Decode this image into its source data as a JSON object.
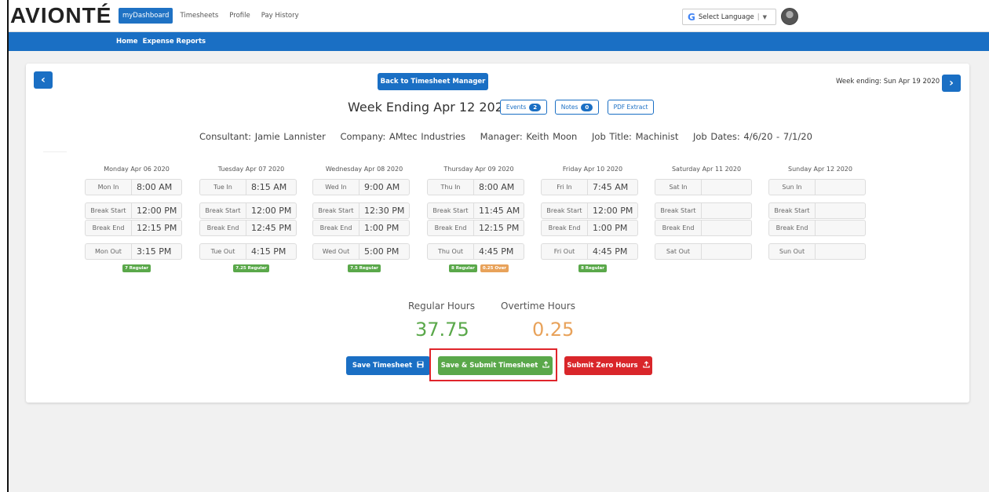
{
  "header": {
    "logo": "AVIONTÉ",
    "nav": [
      "myDashboard",
      "Timesheets",
      "Profile",
      "Pay History"
    ],
    "language_label": "Select Language",
    "language_sep": "|",
    "language_arrow": "▼"
  },
  "subnav": [
    "Home",
    "Expense Reports"
  ],
  "toolbar": {
    "prev_icon": "‹",
    "next_icon": "›",
    "back_label": "Back to Timesheet Manager",
    "week_ending_right": "Week ending: Sun Apr 19 2020"
  },
  "week": {
    "title": "Week Ending Apr 12 2020",
    "events_label": "Events",
    "events_count": "2",
    "notes_label": "Notes",
    "notes_count": "0",
    "pdf_label": "PDF Extract"
  },
  "info": {
    "consultant": "Consultant: Jamie Lannister",
    "company": "Company: AMtec Industries",
    "manager": "Manager: Keith Moon",
    "job_title": "Job Title: Machinist",
    "job_dates": "Job Dates: 4/6/20 - 7/1/20"
  },
  "days": [
    {
      "label": "Monday Apr 06 2020",
      "in_label": "Mon In",
      "in": "8:00 AM",
      "bs_label": "Break Start",
      "bs": "12:00 PM",
      "be_label": "Break End",
      "be": "12:15 PM",
      "out_label": "Mon Out",
      "out": "3:15 PM",
      "regular": "7 Regular",
      "over": ""
    },
    {
      "label": "Tuesday Apr 07 2020",
      "in_label": "Tue In",
      "in": "8:15 AM",
      "bs_label": "Break Start",
      "bs": "12:00 PM",
      "be_label": "Break End",
      "be": "12:45 PM",
      "out_label": "Tue Out",
      "out": "4:15 PM",
      "regular": "7.25 Regular",
      "over": ""
    },
    {
      "label": "Wednesday Apr 08 2020",
      "in_label": "Wed In",
      "in": "9:00 AM",
      "bs_label": "Break Start",
      "bs": "12:30 PM",
      "be_label": "Break End",
      "be": "1:00 PM",
      "out_label": "Wed Out",
      "out": "5:00 PM",
      "regular": "7.5 Regular",
      "over": ""
    },
    {
      "label": "Thursday Apr 09 2020",
      "in_label": "Thu In",
      "in": "8:00 AM",
      "bs_label": "Break Start",
      "bs": "11:45 AM",
      "be_label": "Break End",
      "be": "12:15 PM",
      "out_label": "Thu Out",
      "out": "4:45 PM",
      "regular": "8 Regular",
      "over": "0.25 Over"
    },
    {
      "label": "Friday Apr 10 2020",
      "in_label": "Fri In",
      "in": "7:45 AM",
      "bs_label": "Break Start",
      "bs": "12:00 PM",
      "be_label": "Break End",
      "be": "1:00 PM",
      "out_label": "Fri Out",
      "out": "4:45 PM",
      "regular": "8 Regular",
      "over": ""
    },
    {
      "label": "Saturday Apr 11 2020",
      "in_label": "Sat In",
      "in": "",
      "bs_label": "Break Start",
      "bs": "",
      "be_label": "Break End",
      "be": "",
      "out_label": "Sat Out",
      "out": "",
      "regular": "",
      "over": ""
    },
    {
      "label": "Sunday Apr 12 2020",
      "in_label": "Sun In",
      "in": "",
      "bs_label": "Break Start",
      "bs": "",
      "be_label": "Break End",
      "be": "",
      "out_label": "Sun Out",
      "out": "",
      "regular": "",
      "over": ""
    }
  ],
  "totals": {
    "regular_label": "Regular Hours",
    "regular_value": "37.75",
    "overtime_label": "Overtime Hours",
    "overtime_value": "0.25",
    "regular_color": "#5aa84a",
    "overtime_color": "#e8a25a"
  },
  "actions": {
    "save_label": "Save Timesheet",
    "save_icon": "floppy-disk-icon",
    "submit_label": "Save & Submit Timesheet",
    "submit_icon": "upload-icon",
    "zero_label": "Submit Zero Hours",
    "zero_icon": "upload-icon"
  }
}
